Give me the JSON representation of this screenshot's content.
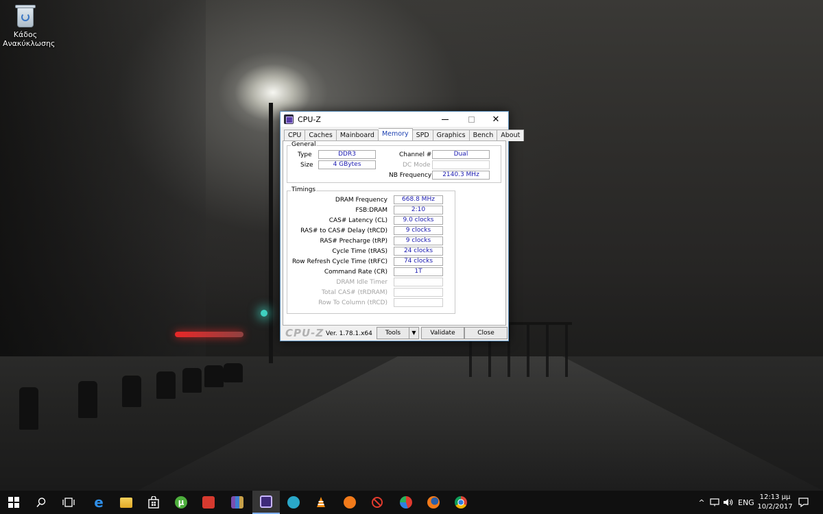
{
  "desktop": {
    "icons": [
      {
        "label": "Κάδος Ανακύκλωσης",
        "icon": "recycle-bin-icon"
      }
    ]
  },
  "window": {
    "title": "CPU-Z",
    "controls": {
      "minimize": "minimize",
      "maximize": "maximize",
      "close": "✕"
    },
    "tabs": [
      "CPU",
      "Caches",
      "Mainboard",
      "Memory",
      "SPD",
      "Graphics",
      "Bench",
      "About"
    ],
    "active_tab": "Memory",
    "general": {
      "title": "General",
      "type_label": "Type",
      "type_value": "DDR3",
      "size_label": "Size",
      "size_value": "4 GBytes",
      "channel_label": "Channel #",
      "channel_value": "Dual",
      "dcmode_label": "DC Mode",
      "dcmode_value": "",
      "nbfreq_label": "NB Frequency",
      "nbfreq_value": "2140.3 MHz"
    },
    "timings": {
      "title": "Timings",
      "rows": [
        {
          "label": "DRAM Frequency",
          "value": "668.8 MHz"
        },
        {
          "label": "FSB:DRAM",
          "value": "2:10"
        },
        {
          "label": "CAS# Latency (CL)",
          "value": "9.0 clocks"
        },
        {
          "label": "RAS# to CAS# Delay (tRCD)",
          "value": "9 clocks"
        },
        {
          "label": "RAS# Precharge (tRP)",
          "value": "9 clocks"
        },
        {
          "label": "Cycle Time (tRAS)",
          "value": "24 clocks"
        },
        {
          "label": "Row Refresh Cycle Time (tRFC)",
          "value": "74 clocks"
        },
        {
          "label": "Command Rate (CR)",
          "value": "1T"
        },
        {
          "label": "DRAM Idle Timer",
          "value": ""
        },
        {
          "label": "Total CAS# (tRDRAM)",
          "value": ""
        },
        {
          "label": "Row To Column (tRCD)",
          "value": ""
        }
      ]
    },
    "footer": {
      "brand": "CPU-Z",
      "version": "Ver. 1.78.1.x64",
      "tools_label": "Tools",
      "tools_arrow": "▼",
      "validate_label": "Validate",
      "close_label": "Close"
    }
  },
  "taskbar": {
    "items": [
      "start",
      "search",
      "task-view",
      "edge",
      "file-explorer",
      "store",
      "utorrent",
      "news-app",
      "winrar",
      "cpu-z",
      "cam-app",
      "vlc",
      "avast",
      "no-entry-app",
      "ccleaner",
      "firefox",
      "chrome"
    ],
    "active_item": "cpu-z",
    "tray": {
      "chevron": "^",
      "language": "ENG",
      "time": "12:13 μμ",
      "date": "10/2/2017"
    }
  }
}
